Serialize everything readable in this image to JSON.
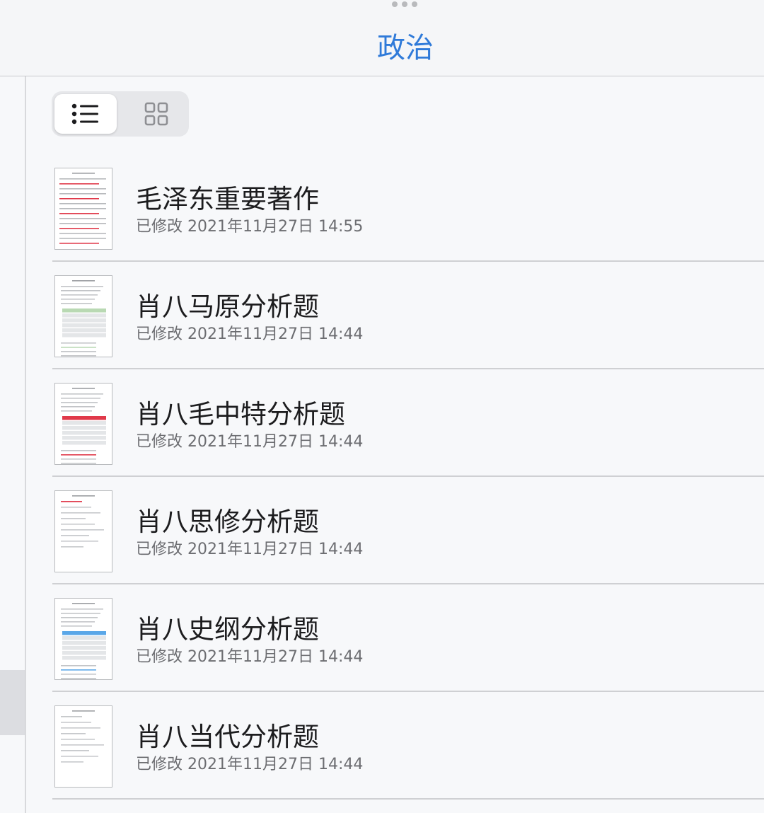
{
  "window": {
    "title": "政治",
    "more_icon": "ellipsis-icon"
  },
  "view_toggle": {
    "list_icon": "list-view-icon",
    "grid_icon": "grid-view-icon",
    "selected": "list"
  },
  "documents": [
    {
      "title": "毛泽东重要著作",
      "modified": "已修改 2021年11月27日 14:55",
      "thumb_style": "red"
    },
    {
      "title": "肖八马原分析题",
      "modified": "已修改 2021年11月27日 14:44",
      "thumb_style": "table-green"
    },
    {
      "title": "肖八毛中特分析题",
      "modified": "已修改 2021年11月27日 14:44",
      "thumb_style": "table-red"
    },
    {
      "title": "肖八思修分析题",
      "modified": "已修改 2021年11月27日 14:44",
      "thumb_style": "sparse-red"
    },
    {
      "title": "肖八史纲分析题",
      "modified": "已修改 2021年11月27日 14:44",
      "thumb_style": "table-blue"
    },
    {
      "title": "肖八当代分析题",
      "modified": "已修改 2021年11月27日 14:44",
      "thumb_style": "sparse"
    }
  ],
  "colors": {
    "accent": "#2f7ad9",
    "highlight_red": "#e0394a",
    "highlight_blue": "#5aa7e8",
    "highlight_green": "#b9d9b3"
  }
}
